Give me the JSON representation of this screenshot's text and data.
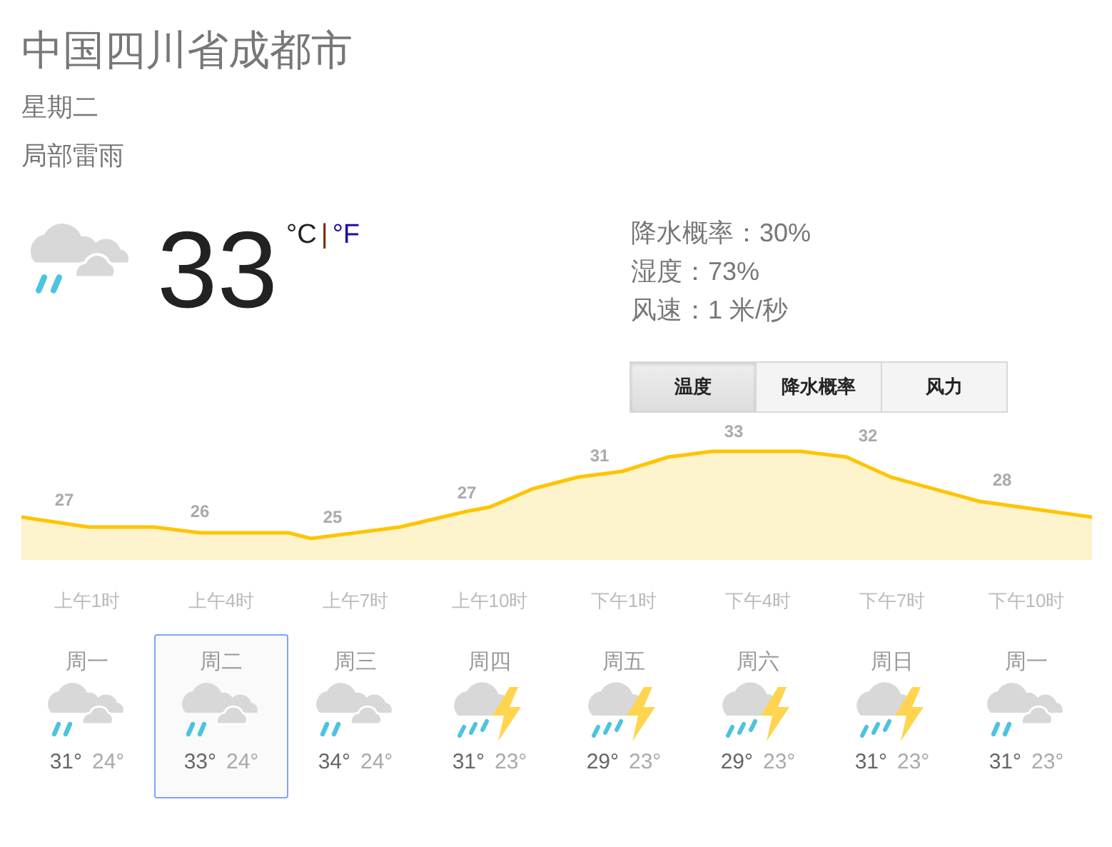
{
  "location": "中国四川省成都市",
  "day": "星期二",
  "condition": "局部雷雨",
  "current": {
    "temperature": "33",
    "units": [
      {
        "label": "°C",
        "selected": true
      },
      {
        "label": "°F",
        "selected": false
      }
    ],
    "separator": "|"
  },
  "details": [
    "降水概率：30%",
    "湿度：73%",
    "风速：1 米/秒"
  ],
  "tabs": [
    {
      "label": "温度",
      "selected": true
    },
    {
      "label": "降水概率",
      "selected": false
    },
    {
      "label": "风力",
      "selected": false
    }
  ],
  "temperature_labels": [
    "27",
    "26",
    "25",
    "27",
    "31",
    "33",
    "32",
    "28"
  ],
  "hours": [
    "上午1时",
    "上午4时",
    "上午7时",
    "上午10时",
    "下午1时",
    "下午4时",
    "下午7时",
    "下午10时"
  ],
  "days": [
    {
      "name": "周一",
      "kind": "rain",
      "high": "31°",
      "low": "24°",
      "selected": false
    },
    {
      "name": "周二",
      "kind": "rain",
      "high": "33°",
      "low": "24°",
      "selected": true
    },
    {
      "name": "周三",
      "kind": "rain",
      "high": "34°",
      "low": "24°",
      "selected": false
    },
    {
      "name": "周四",
      "kind": "thunder",
      "high": "31°",
      "low": "23°",
      "selected": false
    },
    {
      "name": "周五",
      "kind": "thunder",
      "high": "29°",
      "low": "23°",
      "selected": false
    },
    {
      "name": "周六",
      "kind": "thunder",
      "high": "29°",
      "low": "23°",
      "selected": false
    },
    {
      "name": "周日",
      "kind": "thunder",
      "high": "31°",
      "low": "23°",
      "selected": false
    },
    {
      "name": "周一",
      "kind": "rain",
      "high": "31°",
      "low": "23°",
      "selected": false
    }
  ]
}
